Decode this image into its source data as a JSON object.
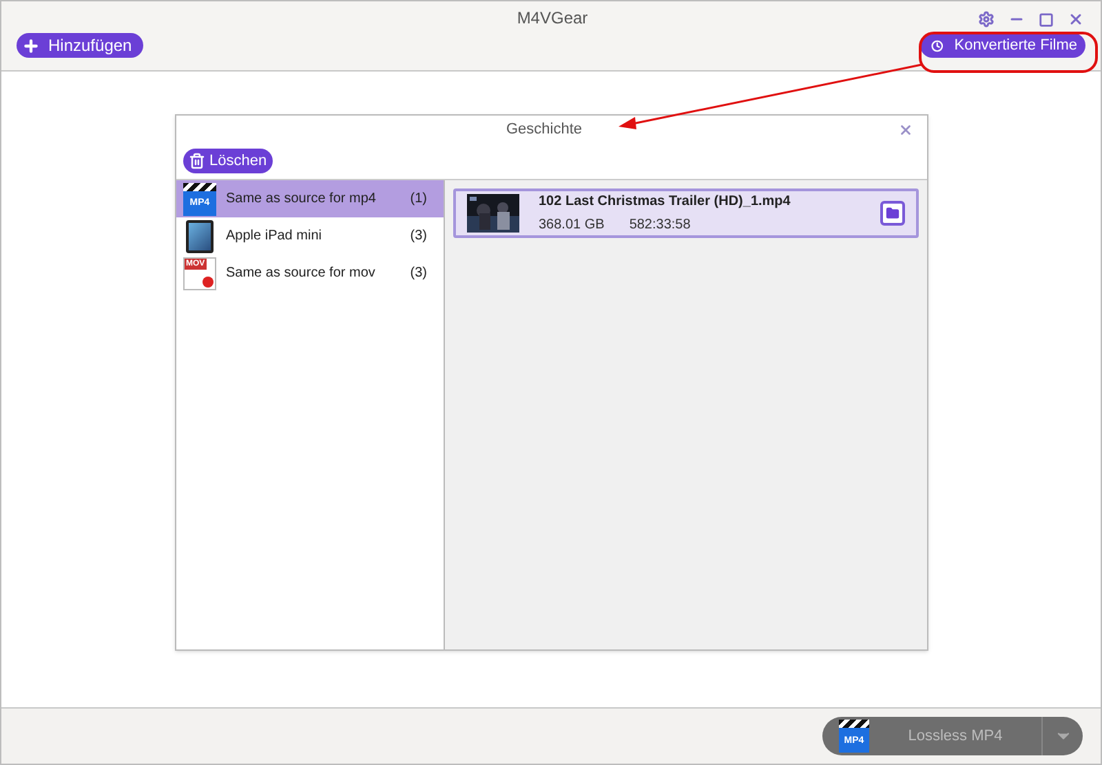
{
  "window": {
    "title": "M4VGear"
  },
  "toolbar": {
    "add_button": "Hinzufügen",
    "converted_button": "Konvertierte Filme"
  },
  "dialog": {
    "title": "Geschichte",
    "delete_button": "Löschen",
    "profiles": [
      {
        "kind": "mp4",
        "badge": "MP4",
        "name": "Same as source for mp4",
        "count": "(1)",
        "selected": true
      },
      {
        "kind": "ipad",
        "name": "Apple iPad mini",
        "count": "(3)",
        "selected": false
      },
      {
        "kind": "mov",
        "badge": "MOV",
        "name": "Same as source for mov",
        "count": "(3)",
        "selected": false
      }
    ],
    "files": [
      {
        "name": "102 Last Christmas Trailer (HD)_1.mp4",
        "size": "368.01 GB",
        "duration": "582:33:58"
      }
    ]
  },
  "footer": {
    "format_badge": "MP4",
    "format": "Lossless MP4"
  }
}
